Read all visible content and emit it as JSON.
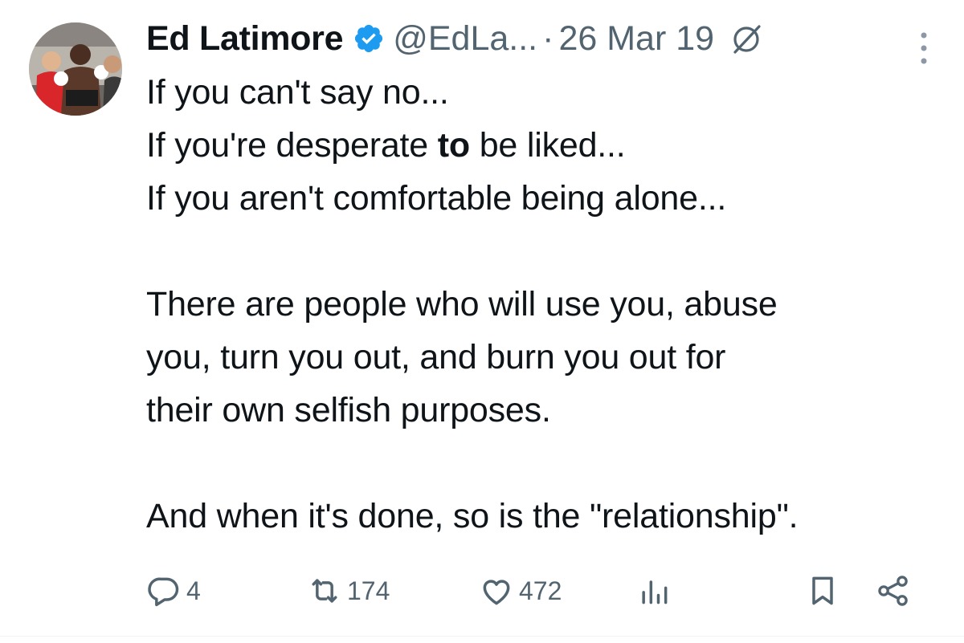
{
  "author": {
    "display_name": "Ed Latimore",
    "handle": "@EdLa...",
    "separator": "·",
    "date": "26 Mar 19",
    "verified": true,
    "verified_color": "#1d9bf0"
  },
  "tweet": {
    "line1": "If you can't say no...",
    "line2_before": "If you're desperate ",
    "line2_bold": "to",
    "line2_after": " be liked...",
    "line3": "If you aren't comfortable being alone...",
    "line4": "There are people who will use you,  abuse",
    "line5": "you, turn you out, and burn you out for",
    "line6": "their own selfish purposes.",
    "line7": "And when it's done, so is the \"relationship\"."
  },
  "actions": {
    "replies": "4",
    "retweets": "174",
    "likes": "472"
  },
  "icons": {
    "verified": "verified-badge-icon",
    "grok": "grok-icon",
    "more": "more-vertical-icon",
    "reply": "reply-icon",
    "retweet": "retweet-icon",
    "like": "heart-icon",
    "views": "views-chart-icon",
    "bookmark": "bookmark-icon",
    "share": "share-icon"
  },
  "colors": {
    "text": "#0f1419",
    "secondary": "#536471",
    "accent": "#1d9bf0"
  }
}
